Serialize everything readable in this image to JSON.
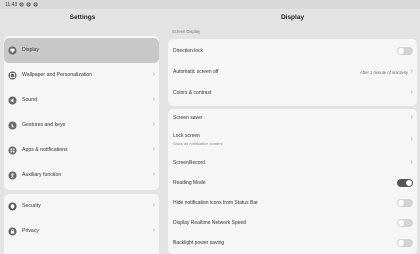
{
  "status_bar": {
    "time": "11:43"
  },
  "settings": {
    "title": "Settings",
    "groups": [
      {
        "items": [
          {
            "label": "Display",
            "icon": "display-icon",
            "selected": true
          },
          {
            "label": "Wallpaper and Personalization",
            "icon": "wallpaper-icon"
          },
          {
            "label": "Sound",
            "icon": "sound-icon"
          },
          {
            "label": "Gestures and keys",
            "icon": "gesture-icon"
          },
          {
            "label": "Apps & notifications",
            "icon": "apps-icon"
          },
          {
            "label": "Auxiliary function",
            "icon": "auxiliary-icon"
          }
        ]
      },
      {
        "items": [
          {
            "label": "Security",
            "icon": "security-icon"
          },
          {
            "label": "Privacy",
            "icon": "privacy-icon"
          }
        ]
      }
    ]
  },
  "display": {
    "title": "Display",
    "section_label": "Screen Display",
    "group1": [
      {
        "label": "Direction lock",
        "control": "toggle",
        "on": false
      },
      {
        "label": "Automatic screen off",
        "value": "After 1 minute of inactivity",
        "control": "chevron"
      },
      {
        "label": "Colors & contrast",
        "control": "chevron"
      }
    ],
    "group2": [
      {
        "label": "Screen saver",
        "control": "chevron"
      },
      {
        "label": "Lock screen",
        "sub": "Show all notification content",
        "control": "chevron"
      },
      {
        "label": "ScreenRecord",
        "control": "chevron"
      },
      {
        "label": "Reading Mode",
        "control": "toggle",
        "on": true
      },
      {
        "label": "Hide notification icons from Status Bar",
        "control": "toggle",
        "on": false
      },
      {
        "label": "Display Realtime Network Speed",
        "control": "toggle",
        "on": false
      },
      {
        "label": "Backlight power saving",
        "control": "toggle",
        "on": false
      }
    ]
  }
}
